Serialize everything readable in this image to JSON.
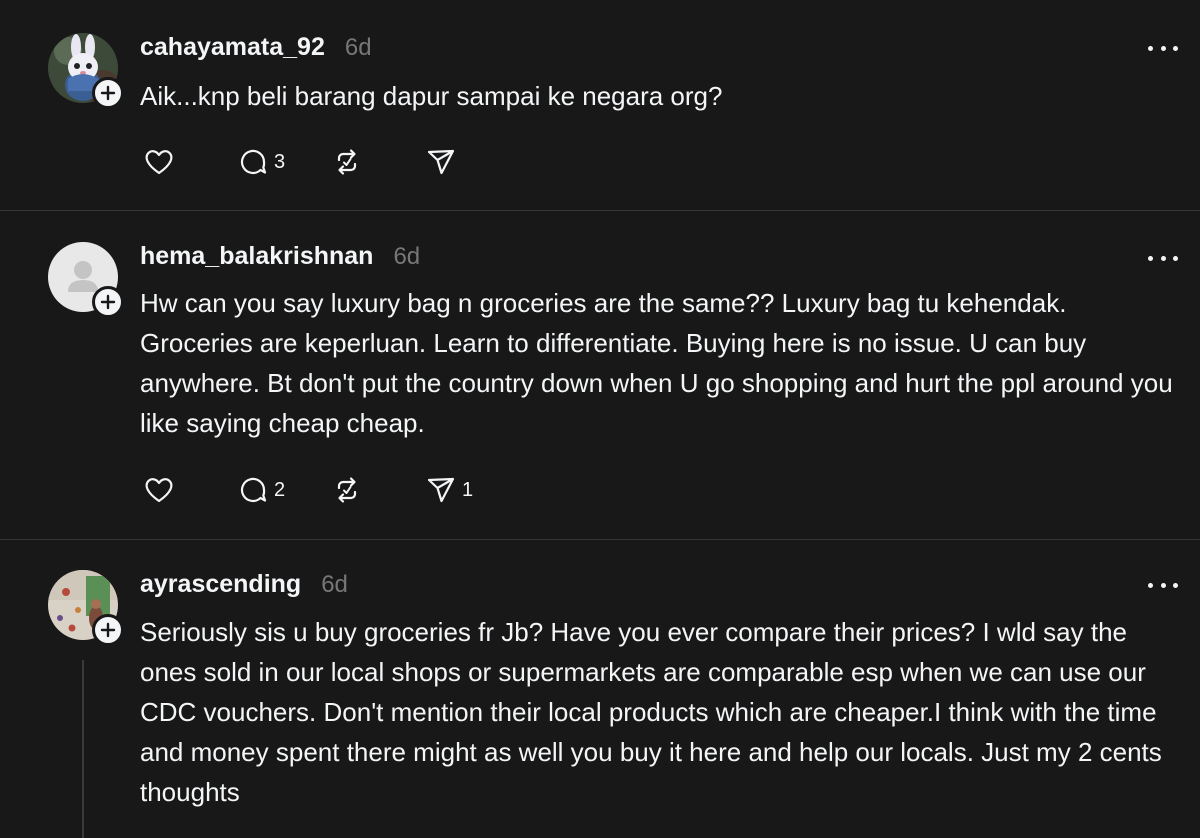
{
  "posts": [
    {
      "username": "cahayamata_92",
      "time": "6d",
      "avatar": "bunny-character-avatar",
      "text": "Aik...knp beli barang dapur sampai ke negara org?",
      "actions": {
        "likes": "",
        "replies": "3",
        "reposts": "",
        "shares": ""
      }
    },
    {
      "username": "hema_balakrishnan",
      "time": "6d",
      "avatar": "default-user-avatar",
      "text": "Hw can you say luxury bag n groceries are the same?? Luxury bag tu kehendak. Groceries are keperluan. Learn to differentiate. Buying here is no issue. U can buy anywhere. Bt don't put the country down when U go shopping and hurt the ppl around you like saying cheap cheap.",
      "actions": {
        "likes": "",
        "replies": "2",
        "reposts": "",
        "shares": "1"
      }
    },
    {
      "username": "ayrascending",
      "time": "6d",
      "avatar": "climbing-wall-avatar",
      "text": "Seriously sis u buy groceries fr Jb? Have you ever compare their prices? I wld say the ones sold in our local shops or supermarkets are comparable esp when we can use our CDC vouchers. Don't mention their local products which are cheaper.I think with the time and money spent there might as well you buy it here and help our locals. Just my 2 cents thoughts"
    }
  ],
  "icons": {
    "like": "heart-icon",
    "reply": "comment-icon",
    "repost": "repost-icon",
    "share": "send-icon",
    "follow": "plus-icon",
    "more": "more-options-icon"
  },
  "colors": {
    "background": "#181818",
    "text": "#f3f5f7",
    "muted": "#777777",
    "divider": "#333638"
  }
}
